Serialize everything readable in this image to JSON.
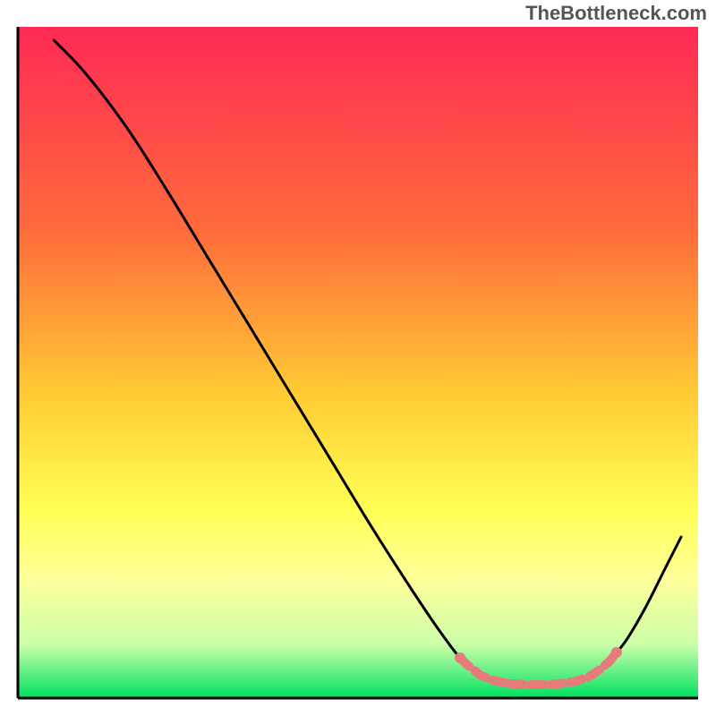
{
  "watermark": "TheBottleneck.com",
  "chart_data": {
    "type": "line",
    "title": "",
    "xlabel": "",
    "ylabel": "",
    "xlim": [
      0,
      100
    ],
    "ylim": [
      0,
      100
    ],
    "gradient_stops": [
      {
        "offset": 0,
        "color": "#ff2a55"
      },
      {
        "offset": 30,
        "color": "#ff6a3c"
      },
      {
        "offset": 55,
        "color": "#ffcc33"
      },
      {
        "offset": 72,
        "color": "#ffff55"
      },
      {
        "offset": 82,
        "color": "#ffff99"
      },
      {
        "offset": 92,
        "color": "#ccffaa"
      },
      {
        "offset": 100,
        "color": "#00e060"
      }
    ],
    "curve": [
      {
        "x": 5.3,
        "y": 98.0
      },
      {
        "x": 10.0,
        "y": 93.0
      },
      {
        "x": 16.0,
        "y": 85.0
      },
      {
        "x": 22.0,
        "y": 75.5
      },
      {
        "x": 28.0,
        "y": 65.5
      },
      {
        "x": 34.0,
        "y": 55.5
      },
      {
        "x": 40.0,
        "y": 45.5
      },
      {
        "x": 46.0,
        "y": 35.5
      },
      {
        "x": 52.0,
        "y": 25.5
      },
      {
        "x": 58.0,
        "y": 16.0
      },
      {
        "x": 62.0,
        "y": 10.0
      },
      {
        "x": 65.0,
        "y": 6.0
      },
      {
        "x": 68.0,
        "y": 3.2
      },
      {
        "x": 71.0,
        "y": 2.3
      },
      {
        "x": 74.0,
        "y": 2.0
      },
      {
        "x": 77.0,
        "y": 2.0
      },
      {
        "x": 80.0,
        "y": 2.2
      },
      {
        "x": 83.0,
        "y": 2.8
      },
      {
        "x": 86.0,
        "y": 4.8
      },
      {
        "x": 89.0,
        "y": 8.0
      },
      {
        "x": 92.0,
        "y": 13.0
      },
      {
        "x": 95.0,
        "y": 19.0
      },
      {
        "x": 97.5,
        "y": 24.0
      }
    ],
    "valley_markers": [
      {
        "x": 65.0,
        "y": 6.0
      },
      {
        "x": 66.0,
        "y": 5.0
      },
      {
        "x": 68.0,
        "y": 3.4
      },
      {
        "x": 70.0,
        "y": 2.6
      },
      {
        "x": 72.0,
        "y": 2.2
      },
      {
        "x": 74.0,
        "y": 2.0
      },
      {
        "x": 75.5,
        "y": 2.0
      },
      {
        "x": 77.0,
        "y": 2.0
      },
      {
        "x": 78.5,
        "y": 2.05
      },
      {
        "x": 80.0,
        "y": 2.2
      },
      {
        "x": 82.0,
        "y": 2.5
      },
      {
        "x": 84.0,
        "y": 3.2
      },
      {
        "x": 85.5,
        "y": 4.2
      },
      {
        "x": 87.0,
        "y": 5.5
      },
      {
        "x": 88.0,
        "y": 6.8
      }
    ]
  }
}
